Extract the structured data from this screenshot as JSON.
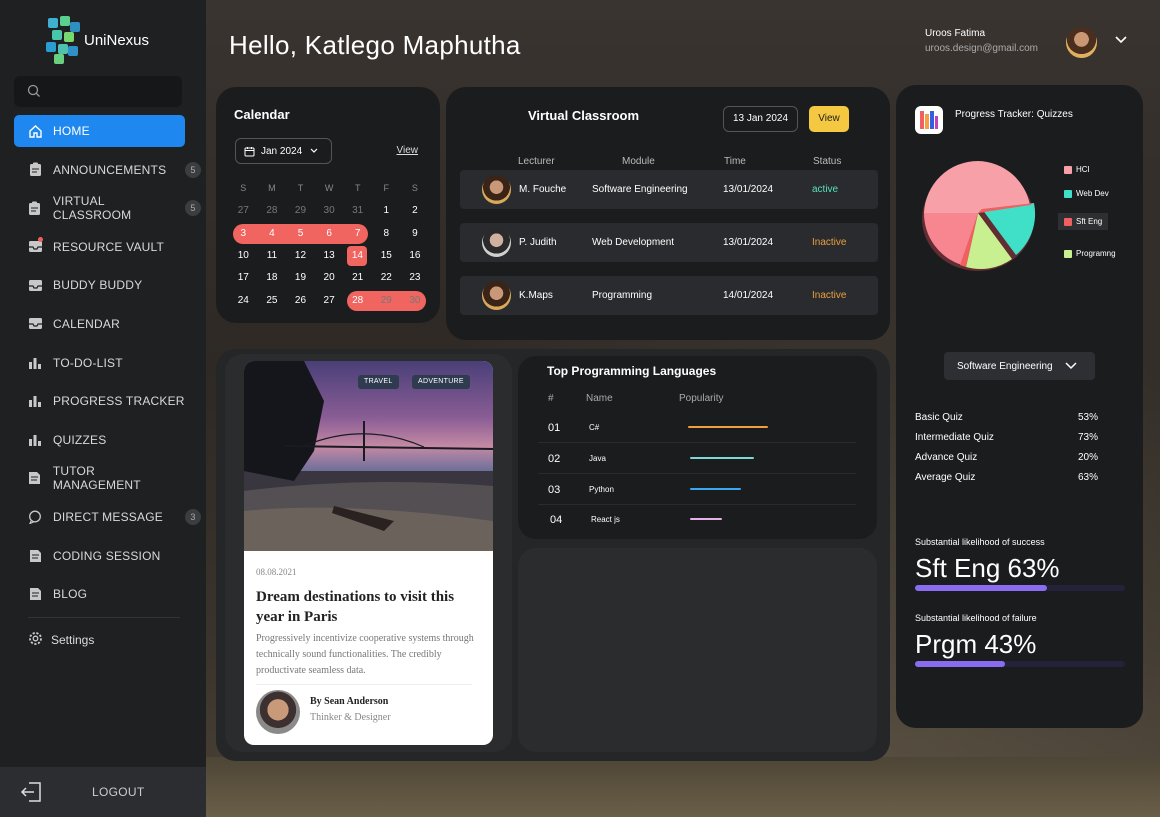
{
  "app": {
    "name": "UniNexus"
  },
  "search": {
    "placeholder": ""
  },
  "sidebar": {
    "items": [
      {
        "label": "HOME",
        "icon": "home-icon",
        "active": true
      },
      {
        "label": "ANNOUNCEMENTS",
        "icon": "clipboard-icon",
        "badge": "5"
      },
      {
        "label": "VIRTUAL CLASSROOM",
        "icon": "clipboard-icon",
        "badge": "5"
      },
      {
        "label": "RESOURCE VAULT",
        "icon": "inbox-icon"
      },
      {
        "label": "BUDDY BUDDY",
        "icon": "inbox-icon"
      },
      {
        "label": "CALENDAR",
        "icon": "inbox-icon"
      },
      {
        "label": "TO-DO-LIST",
        "icon": "bar-chart-icon"
      },
      {
        "label": "PROGRESS TRACKER",
        "icon": "bar-chart-icon"
      },
      {
        "label": "QUIZZES",
        "icon": "bar-chart-icon"
      },
      {
        "label": "TUTOR MANAGEMENT",
        "icon": "document-icon"
      },
      {
        "label": "DIRECT MESSAGE",
        "icon": "chat-icon",
        "badge": "3"
      },
      {
        "label": "CODING SESSION",
        "icon": "document-icon"
      },
      {
        "label": "BLOG",
        "icon": "document-icon"
      }
    ],
    "settings": "Settings",
    "logout": "LOGOUT"
  },
  "header": {
    "greeting": "Hello, Katlego Maphutha",
    "user_name": "Uroos Fatima",
    "user_email": "uroos.design@gmail.com"
  },
  "calendar": {
    "title": "Calendar",
    "month": "Jan 2024",
    "view": "View",
    "weekdays": [
      "S",
      "M",
      "T",
      "W",
      "T",
      "F",
      "S"
    ],
    "weeks": [
      [
        "27",
        "28",
        "29",
        "30",
        "31",
        "1",
        "2"
      ],
      [
        "3",
        "4",
        "5",
        "6",
        "7",
        "8",
        "9"
      ],
      [
        "10",
        "11",
        "12",
        "13",
        "14",
        "15",
        "16"
      ],
      [
        "17",
        "18",
        "19",
        "20",
        "21",
        "22",
        "23"
      ],
      [
        "24",
        "25",
        "26",
        "27",
        "28",
        "29",
        "30"
      ]
    ]
  },
  "classroom": {
    "title": "Virtual Classroom",
    "date": "13 Jan 2024",
    "view_button": "View",
    "columns": [
      "Lecturer",
      "Module",
      "Time",
      "Status"
    ],
    "rows": [
      {
        "lecturer": "M. Fouche",
        "module": "Software Engineering",
        "time": "13/01/2024",
        "status": "active"
      },
      {
        "lecturer": "P. Judith",
        "module": "Web Development",
        "time": "13/01/2024",
        "status": "Inactive"
      },
      {
        "lecturer": "K.Maps",
        "module": "Programming",
        "time": "14/01/2024",
        "status": "Inactive"
      }
    ]
  },
  "progress": {
    "title": "Progress Tracker: Quizzes",
    "legend": [
      {
        "label": "HCI",
        "color": "#f8a0a8"
      },
      {
        "label": "Web Dev",
        "color": "#40e0c8"
      },
      {
        "label": "Sft Eng",
        "color": "#f06060"
      },
      {
        "label": "Programng",
        "color": "#c8f090"
      }
    ],
    "dropdown": "Software Engineering",
    "quizzes": [
      {
        "name": "Basic Quiz",
        "value": "53%"
      },
      {
        "name": "Intermediate Quiz",
        "value": "73%"
      },
      {
        "name": "Advance Quiz",
        "value": "20%"
      },
      {
        "name": "Average Quiz",
        "value": "63%"
      }
    ],
    "success_label": "Substantial likelihood of success",
    "success_value": "Sft Eng 63%",
    "success_level": 0.63,
    "failure_label": "Substantial likelihood of failure",
    "failure_value": "Prgm 43%",
    "failure_level": 0.43
  },
  "blog": {
    "tags": [
      "TRAVEL",
      "ADVENTURE"
    ],
    "date": "08.08.2021",
    "title": "Dream destinations to visit this year in Paris",
    "description": "Progressively incentivize cooperative systems through technically sound functionalities. The credibly productivate seamless data.",
    "author": "By Sean Anderson",
    "role": "Thinker & Designer"
  },
  "languages": {
    "title": "Top Programming Languages",
    "columns": [
      "#",
      "Name",
      "Popularity"
    ],
    "rows": [
      {
        "num": "01",
        "name": "C#",
        "color": "#f0a040"
      },
      {
        "num": "02",
        "name": "Java",
        "color": "#7ed8d8"
      },
      {
        "num": "03",
        "name": "Python",
        "color": "#3aa8f0"
      },
      {
        "num": "04",
        "name": "React js",
        "color": "#e8b0e8"
      }
    ]
  }
}
